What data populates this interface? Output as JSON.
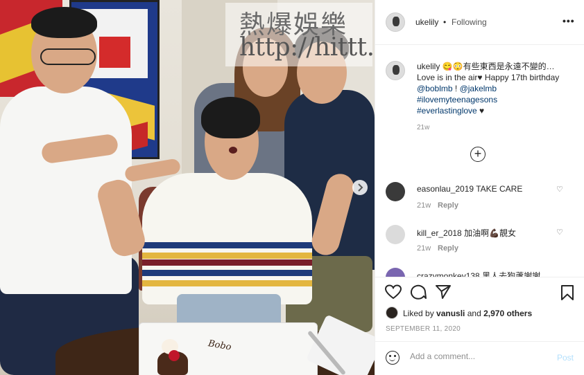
{
  "watermark": {
    "title": "熱爆娛樂",
    "url": "http://hittt.blogspot.com"
  },
  "photo": {
    "plate_text": "Bobo",
    "next_icon": "chevron-right-icon"
  },
  "header": {
    "username": "ukelily",
    "separator": "•",
    "follow_status": "Following",
    "more_icon": "ellipsis-icon",
    "more_label": "•••"
  },
  "caption": {
    "username": "ukelily",
    "emoji_line": "😋😳有些東西是永遠不變的…",
    "text_part1": "Love is in the air♥ Happy 17th birthday ",
    "mention1": "@boblmb",
    "text_part2": " ! ",
    "mention2": "@jakelmb",
    "hashtag1": "#ilovemyteenagesons",
    "hashtag2": "#everlastinglove",
    "heart": " ♥",
    "time": "21w"
  },
  "load_more_icon": "plus-circle-icon",
  "load_more_label": "+",
  "comments": [
    {
      "username": "easonlau_2019",
      "text": "TAKE CARE",
      "time": "21w",
      "reply": "Reply",
      "avatar_color": "#3a3a3a"
    },
    {
      "username": "kill_er_2018",
      "text": "加油啊💪🏿靚女",
      "time": "21w",
      "reply": "Reply",
      "avatar_color": "#dbdbdb"
    },
    {
      "username": "crazymonkey138",
      "text": "黑人去狗蘆謝謝",
      "avatar_color": "#7a66b0"
    }
  ],
  "heart_glyph": "♡",
  "actions": {
    "like_icon": "heart-icon",
    "comment_icon": "comment-icon",
    "share_icon": "send-icon",
    "save_icon": "bookmark-icon"
  },
  "likes": {
    "prefix": "Liked by ",
    "user": "vanusli",
    "middle": " and ",
    "count": "2,970 others"
  },
  "post_date": "SEPTEMBER 11, 2020",
  "comment_bar": {
    "emoji_icon": "smiley-icon",
    "placeholder": "Add a comment...",
    "post_label": "Post",
    "post_color": "#b2dffc"
  }
}
